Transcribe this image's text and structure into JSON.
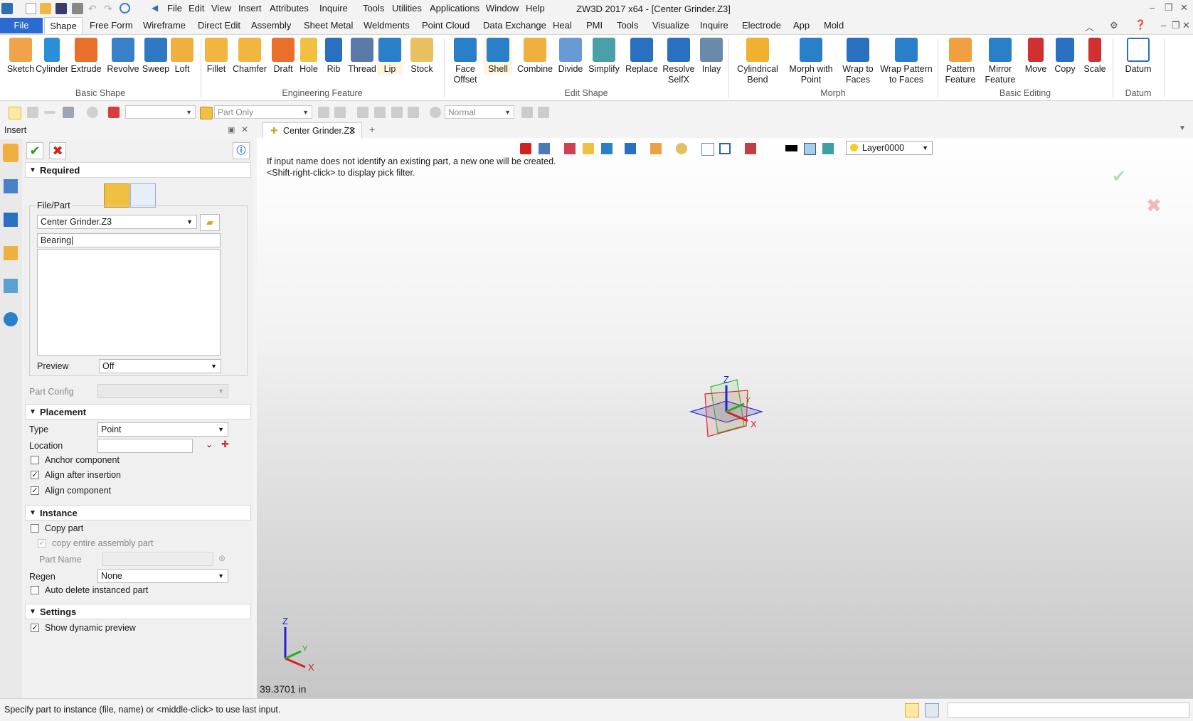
{
  "window": {
    "title": "ZW3D 2017  x64 - [Center Grinder.Z3]",
    "menu": [
      "File",
      "Edit",
      "View",
      "Insert",
      "Attributes",
      "Inquire",
      "Tools",
      "Utilities",
      "Applications",
      "Window",
      "Help"
    ]
  },
  "ribbon_tabs": [
    "File",
    "Shape",
    "Free Form",
    "Wireframe",
    "Direct Edit",
    "Assembly",
    "Sheet Metal",
    "Weldments",
    "Point Cloud",
    "Data Exchange",
    "Heal",
    "PMI",
    "Tools",
    "Visualize",
    "Inquire",
    "Electrode",
    "App",
    "Mold"
  ],
  "ribbon": {
    "basic_shape": {
      "label": "Basic Shape",
      "buttons": [
        "Sketch",
        "Cylinder",
        "Extrude",
        "Revolve",
        "Sweep",
        "Loft"
      ]
    },
    "engineering_feature": {
      "label": "Engineering Feature",
      "buttons": [
        "Fillet",
        "Chamfer",
        "Draft",
        "Hole",
        "Rib",
        "Thread",
        "Lip",
        "Stock"
      ]
    },
    "edit_shape": {
      "label": "Edit Shape",
      "buttons": [
        "Face\nOffset",
        "Shell",
        "Combine",
        "Divide",
        "Simplify",
        "Replace",
        "Resolve\nSelfX",
        "Inlay"
      ]
    },
    "morph": {
      "label": "Morph",
      "buttons": [
        "Cylindrical\nBend",
        "Morph with\nPoint",
        "Wrap to\nFaces",
        "Wrap Pattern\nto Faces"
      ]
    },
    "basic_editing": {
      "label": "Basic Editing",
      "buttons": [
        "Pattern\nFeature",
        "Mirror\nFeature",
        "Move",
        "Copy",
        "Scale"
      ]
    },
    "datum": {
      "label": "Datum",
      "buttons": [
        "Datum"
      ]
    }
  },
  "toolbar2": {
    "filter": "Part Only",
    "mode": "Normal"
  },
  "panel": {
    "title": "Insert",
    "required_label": "Required",
    "file_part_label": "File/Part",
    "file_value": "Center Grinder.Z3",
    "name_value": "Bearing",
    "preview_label": "Preview",
    "preview_value": "Off",
    "part_config_label": "Part Config",
    "placement_label": "Placement",
    "type_label": "Type",
    "type_value": "Point",
    "location_label": "Location",
    "anchor_label": "Anchor component",
    "align_after_label": "Align after insertion",
    "align_comp_label": "Align component",
    "instance_label": "Instance",
    "copy_part_label": "Copy part",
    "copy_entire_label": "copy entire assembly part",
    "part_name_label": "Part  Name",
    "regen_label": "Regen",
    "regen_value": "None",
    "auto_delete_label": "Auto delete instanced part",
    "settings_label": "Settings",
    "show_preview_label": "Show dynamic preview"
  },
  "document": {
    "tab": "Center Grinder.Z3",
    "hint1": "If input name does not identify an existing part, a new one will be created.",
    "hint2": "<Shift-right-click> to display pick filter.",
    "layer": "Layer0000",
    "scale": "39.3701 in"
  },
  "status": "Specify part to instance (file, name) or <middle-click> to use last input."
}
